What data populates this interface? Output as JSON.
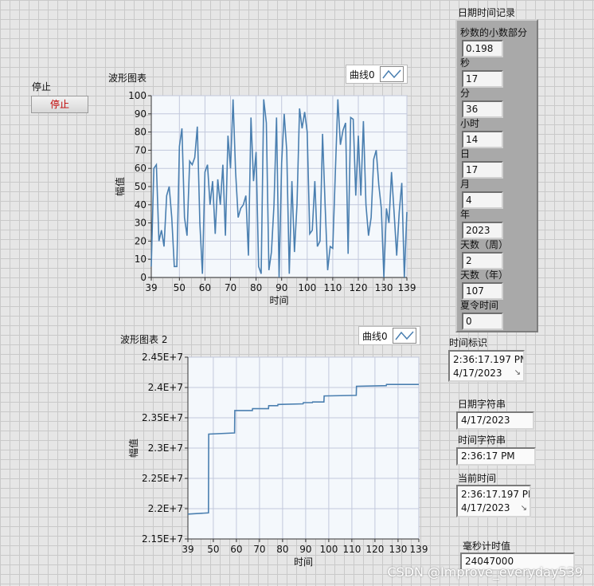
{
  "stop": {
    "label": "停止",
    "button_label": "停止"
  },
  "chart1": {
    "title": "波形图表",
    "legend": "曲线0",
    "xlabel": "时间",
    "ylabel": "幅值"
  },
  "chart2": {
    "title": "波形图表 2",
    "legend": "曲线0",
    "xlabel": "时间",
    "ylabel": "幅值"
  },
  "record": {
    "title": "日期时间记录",
    "fields": [
      {
        "label": "秒数的小数部分",
        "value": "0.198"
      },
      {
        "label": "秒",
        "value": "17"
      },
      {
        "label": "分",
        "value": "36"
      },
      {
        "label": "小时",
        "value": "14"
      },
      {
        "label": "日",
        "value": "17"
      },
      {
        "label": "月",
        "value": "4"
      },
      {
        "label": "年",
        "value": "2023"
      },
      {
        "label": "天数（周）",
        "value": "2"
      },
      {
        "label": "天数（年）",
        "value": "107"
      },
      {
        "label": "夏令时间",
        "value": "0"
      }
    ]
  },
  "timestamp": {
    "label": "时间标识",
    "line1": "2:36:17.197 PM",
    "line2": "4/17/2023"
  },
  "date_string": {
    "label": "日期字符串",
    "value": "4/17/2023"
  },
  "time_string": {
    "label": "时间字符串",
    "value": "2:36:17 PM"
  },
  "current_time": {
    "label": "当前时间",
    "line1": "2:36:17.197 PM",
    "line2": "4/17/2023"
  },
  "ms_timer": {
    "label": "毫秒计时值",
    "value": "24047000"
  },
  "watermark": "CSDN @Improve_everyday539",
  "chart_data": [
    {
      "type": "line",
      "title": "波形图表",
      "xlabel": "时间",
      "ylabel": "幅值",
      "xlim": [
        39,
        139
      ],
      "ylim": [
        0,
        100
      ],
      "xticks": [
        39,
        50,
        60,
        70,
        80,
        90,
        100,
        110,
        120,
        130,
        139
      ],
      "yticks": [
        0,
        10,
        20,
        30,
        40,
        50,
        60,
        70,
        80,
        90,
        100
      ],
      "grid": true,
      "legend": "top-right",
      "color": "#4a7fb0",
      "series": [
        {
          "name": "曲线0",
          "x": [
            39,
            40,
            41,
            42,
            43,
            44,
            45,
            46,
            47,
            48,
            49,
            50,
            51,
            52,
            53,
            54,
            55,
            56,
            57,
            58,
            59,
            60,
            61,
            62,
            63,
            64,
            65,
            66,
            67,
            68,
            69,
            70,
            71,
            72,
            73,
            74,
            75,
            76,
            77,
            78,
            79,
            80,
            81,
            82,
            83,
            84,
            85,
            86,
            87,
            88,
            89,
            90,
            91,
            92,
            93,
            94,
            95,
            96,
            97,
            98,
            99,
            100,
            101,
            102,
            103,
            104,
            105,
            106,
            107,
            108,
            109,
            110,
            111,
            112,
            113,
            114,
            115,
            116,
            117,
            118,
            119,
            120,
            121,
            122,
            123,
            124,
            125,
            126,
            127,
            128,
            129,
            130,
            131,
            132,
            133,
            134,
            135,
            136,
            137,
            138,
            139
          ],
          "y": [
            6,
            60,
            62,
            20,
            26,
            17,
            45,
            50,
            33,
            6,
            6,
            72,
            82,
            33,
            23,
            64,
            62,
            66,
            83,
            30,
            2,
            58,
            62,
            40,
            53,
            24,
            54,
            40,
            62,
            23,
            78,
            60,
            98,
            58,
            33,
            38,
            40,
            45,
            12,
            88,
            53,
            69,
            6,
            2,
            98,
            85,
            4,
            14,
            40,
            88,
            0,
            63,
            90,
            70,
            2,
            53,
            14,
            40,
            93,
            82,
            91,
            80,
            24,
            26,
            53,
            17,
            20,
            79,
            40,
            4,
            17,
            16,
            57,
            98,
            73,
            81,
            85,
            13,
            88,
            87,
            45,
            78,
            45,
            86,
            40,
            23,
            33,
            65,
            70,
            51,
            38,
            0,
            38,
            30,
            58,
            36,
            12,
            36,
            52,
            0,
            36
          ]
        }
      ]
    },
    {
      "type": "line",
      "title": "波形图表 2",
      "xlabel": "时间",
      "ylabel": "幅值",
      "xlim": [
        39,
        139
      ],
      "ylim": [
        21500000,
        24500000
      ],
      "xticks": [
        39,
        50,
        60,
        70,
        80,
        90,
        100,
        110,
        120,
        130,
        139
      ],
      "yticks": [
        "2.15E+7",
        "2.2E+7",
        "2.25E+7",
        "2.3E+7",
        "2.35E+7",
        "2.4E+7",
        "2.45E+7"
      ],
      "grid": true,
      "legend": "top-right",
      "color": "#4a7fb0",
      "series": [
        {
          "name": "曲线0",
          "x": [
            39,
            47.9,
            48,
            59.2,
            59.3,
            66.9,
            67,
            73.9,
            74,
            77.9,
            78,
            88.9,
            89,
            92.9,
            93,
            97.9,
            98,
            111.9,
            112,
            124.9,
            125,
            139
          ],
          "y": [
            21910000,
            21930000,
            23230000,
            23250000,
            23620000,
            23620000,
            23650000,
            23650000,
            23700000,
            23700000,
            23720000,
            23730000,
            23750000,
            23750000,
            23760000,
            23760000,
            23860000,
            23870000,
            24020000,
            24030000,
            24050000,
            24050000
          ]
        }
      ]
    }
  ]
}
